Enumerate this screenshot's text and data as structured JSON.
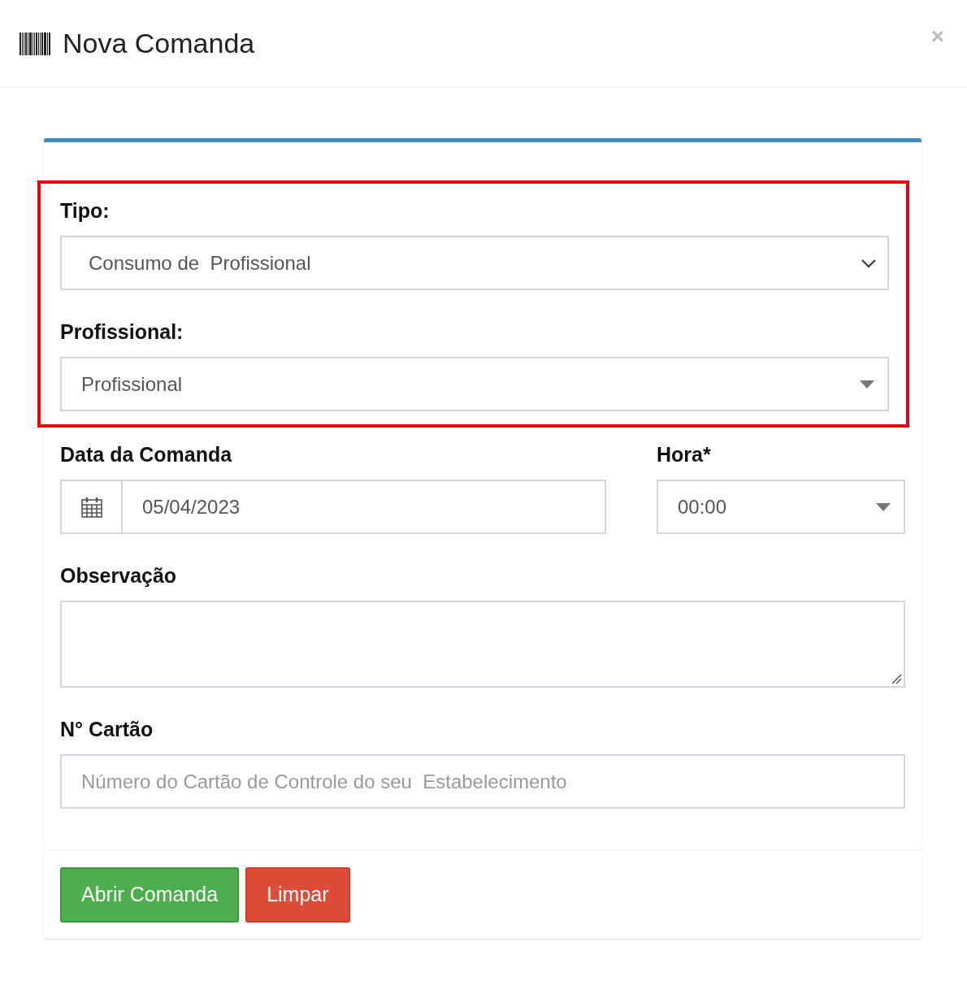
{
  "window": {
    "title": "Nova Comanda",
    "close": "×"
  },
  "groups": [
    {
      "highlighted": true,
      "rows": [
        [
          {
            "kind": "select",
            "label": "Tipo:",
            "value": "Consumo de  Profissional"
          }
        ],
        [
          {
            "kind": "dropdown",
            "label": "Profissional:",
            "value": "Profissional"
          }
        ]
      ]
    },
    {
      "highlighted": false,
      "rows": [
        [
          {
            "kind": "date",
            "label": "Data da Comanda",
            "value": "05/04/2023"
          },
          {
            "kind": "dropdown",
            "label": "Hora*",
            "value": "00:00"
          }
        ],
        [
          {
            "kind": "textarea",
            "label": "Observação"
          }
        ],
        [
          {
            "kind": "text",
            "label": "N° Cartão",
            "placeholder": "Número do Cartão de Controle do seu  Estabelecimento"
          }
        ]
      ]
    }
  ],
  "buttons": [
    {
      "label": "Abrir Comanda",
      "kind": "primary"
    },
    {
      "label": "Limpar",
      "kind": "danger"
    }
  ]
}
